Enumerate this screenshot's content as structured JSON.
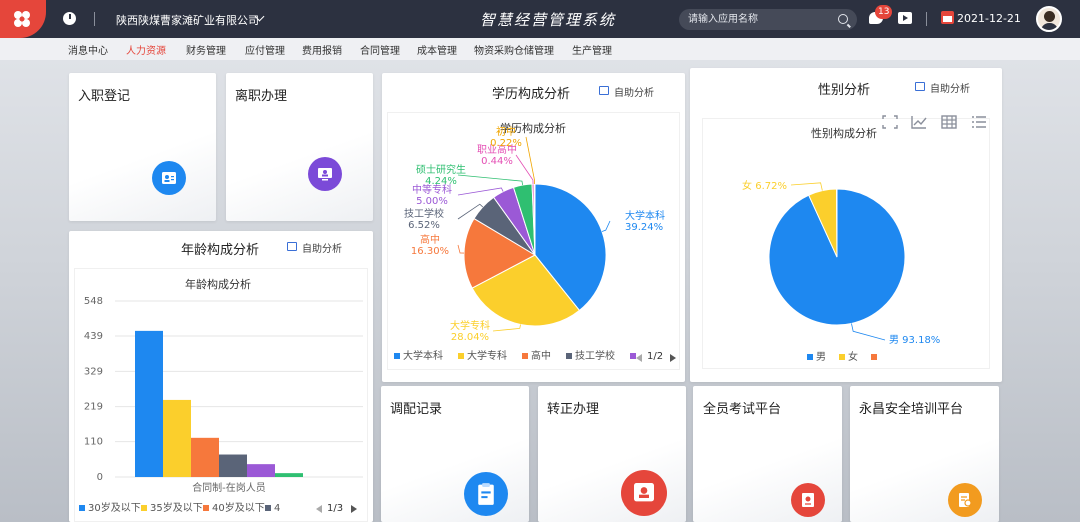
{
  "topbar": {
    "company": "陕西陕煤曹家滩矿业有限公司",
    "system_title": "智慧经营管理系统",
    "search_placeholder": "请输入应用名称",
    "message_count": "13",
    "date": "2021-12-21",
    "brand_color": "#e5463b"
  },
  "nav": {
    "items": [
      "消息中心",
      "人力资源",
      "财务管理",
      "应付管理",
      "费用报销",
      "合同管理",
      "成本管理",
      "物资采购仓储管理",
      "生产管理"
    ],
    "active": "人力资源"
  },
  "tiles": {
    "onboard": {
      "title": "入职登记",
      "icon": "id-card-icon"
    },
    "resign": {
      "title": "离职办理",
      "icon": "monitor-user-icon"
    },
    "transfer": {
      "title": "调配记录",
      "icon": "clipboard-icon"
    },
    "regular": {
      "title": "转正办理",
      "icon": "badge-user-icon"
    },
    "exam": {
      "title": "全员考试平台",
      "icon": "certificate-icon"
    },
    "safety": {
      "title": "永昌安全培训平台",
      "icon": "document-seal-icon"
    }
  },
  "self_analysis_label": "自助分析",
  "age_panel": {
    "header": "年龄构成分析",
    "chart_data": {
      "type": "bar",
      "title": "年龄构成分析",
      "xlabel": "合同制-在岗人员",
      "ylabel": "",
      "ylim": [
        0,
        548
      ],
      "yticks": [
        "0",
        "110",
        "219",
        "329",
        "439",
        "548"
      ],
      "series": [
        {
          "name": "30岁及以下",
          "value": 455,
          "color": "#1e88f0"
        },
        {
          "name": "35岁及以下",
          "value": 240,
          "color": "#fbcf2c"
        },
        {
          "name": "40岁及以下",
          "value": 122,
          "color": "#f6783c"
        },
        {
          "name": "4",
          "value": 70,
          "color": "#5a6478"
        },
        {
          "name": "",
          "value": 40,
          "color": "#9b59d6"
        },
        {
          "name": "",
          "value": 12,
          "color": "#2fbf71"
        }
      ],
      "legend_page": "1/3"
    }
  },
  "edu_panel": {
    "header": "学历构成分析",
    "chart_data": {
      "type": "pie",
      "title": "学历构成分析",
      "slices": [
        {
          "name": "大学本科",
          "value": 39.24,
          "label": "大学本科\n39.24%",
          "color": "#1e88f0"
        },
        {
          "name": "大学专科",
          "value": 28.04,
          "label": "大学专科\n28.04%",
          "color": "#fbcf2c"
        },
        {
          "name": "高中",
          "value": 16.3,
          "label": "高中\n16.30%",
          "color": "#f6783c"
        },
        {
          "name": "技工学校",
          "value": 6.52,
          "label": "技工学校\n6.52%",
          "color": "#5a6478"
        },
        {
          "name": "中等专科",
          "value": 5.0,
          "label": "中等专科\n5.00%",
          "color": "#9b59d6"
        },
        {
          "name": "硕士研究生",
          "value": 4.24,
          "label": "硕士研究生\n4.24%",
          "color": "#2fbf71"
        },
        {
          "name": "职业高中",
          "value": 0.44,
          "label": "职业高中\n0.44%",
          "color": "#e44fb4"
        },
        {
          "name": "初中",
          "value": 0.22,
          "label": "初中\n0.22%",
          "color": "#f0a500"
        }
      ],
      "legend": [
        "大学本科",
        "大学专科",
        "高中",
        "技工学校",
        ""
      ],
      "legend_page": "1/2"
    }
  },
  "gender_panel": {
    "header": "性别分析",
    "chart_data": {
      "type": "pie",
      "title": "性别构成分析",
      "slices": [
        {
          "name": "男",
          "value": 93.18,
          "label": "男 93.18%",
          "color": "#1e88f0"
        },
        {
          "name": "女",
          "value": 6.72,
          "label": "女 6.72%",
          "color": "#fbcf2c"
        },
        {
          "name": "",
          "value": 0.1,
          "label": "",
          "color": "#f6783c"
        }
      ],
      "legend": [
        "男",
        "女",
        ""
      ]
    }
  }
}
